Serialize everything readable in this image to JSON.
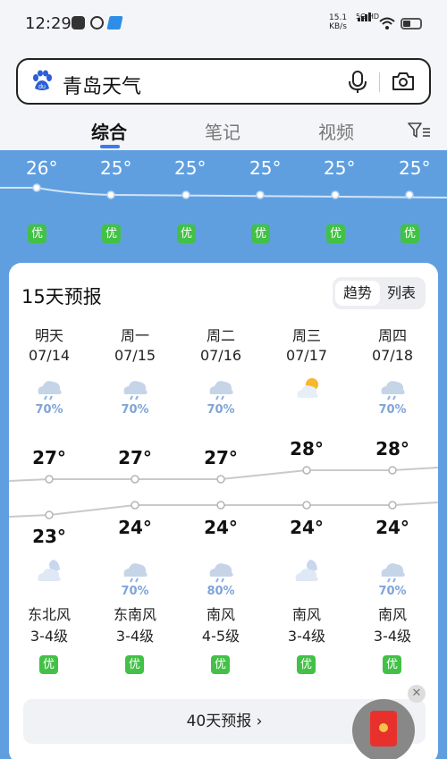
{
  "status_bar": {
    "time": "12:29",
    "net_speed": "15.1",
    "net_unit": "KB/s",
    "signal_label": "5G HD"
  },
  "search": {
    "query": "青岛天气"
  },
  "tabs": [
    {
      "label": "综合"
    },
    {
      "label": "笔记"
    },
    {
      "label": "视频"
    }
  ],
  "hourly": {
    "temps": [
      "26°",
      "25°",
      "25°",
      "25°",
      "25°",
      "25°"
    ],
    "air_quality": [
      "优",
      "优",
      "优",
      "优",
      "优",
      "优"
    ]
  },
  "forecast": {
    "title": "15天预报",
    "toggle": {
      "trend": "趋势",
      "list": "列表"
    },
    "days": [
      {
        "name": "明天",
        "date": "07/14",
        "day_icon": "cloud-rain-icon",
        "day_pct": "70%",
        "high": "27°",
        "low": "23°",
        "night_icon": "moon-cloud-icon",
        "night_pct": "",
        "wind": "东北风",
        "wind_level": "3-4级",
        "aq": "优"
      },
      {
        "name": "周一",
        "date": "07/15",
        "day_icon": "cloud-rain-icon",
        "day_pct": "70%",
        "high": "27°",
        "low": "24°",
        "night_icon": "cloud-rain-icon",
        "night_pct": "70%",
        "wind": "东南风",
        "wind_level": "3-4级",
        "aq": "优"
      },
      {
        "name": "周二",
        "date": "07/16",
        "day_icon": "cloud-rain-icon",
        "day_pct": "70%",
        "high": "27°",
        "low": "24°",
        "night_icon": "cloud-rain-icon",
        "night_pct": "80%",
        "wind": "南风",
        "wind_level": "4-5级",
        "aq": "优"
      },
      {
        "name": "周三",
        "date": "07/17",
        "day_icon": "sun-cloud-icon",
        "day_pct": "",
        "high": "28°",
        "low": "24°",
        "night_icon": "moon-cloud-icon",
        "night_pct": "",
        "wind": "南风",
        "wind_level": "3-4级",
        "aq": "优"
      },
      {
        "name": "周四",
        "date": "07/18",
        "day_icon": "cloud-rain-icon",
        "day_pct": "70%",
        "high": "28°",
        "low": "24°",
        "night_icon": "cloud-rain-icon",
        "night_pct": "70%",
        "wind": "南风",
        "wind_level": "3-4级",
        "aq": "优"
      }
    ],
    "more_label": "40天预报 ›"
  },
  "colors": {
    "accent": "#3a7cf0",
    "aq_good": "#42c146",
    "sky": "#5f9fe0"
  }
}
